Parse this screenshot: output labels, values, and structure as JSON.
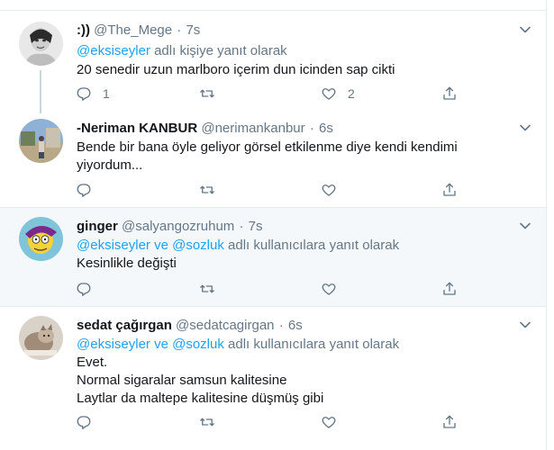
{
  "tweets": [
    {
      "name": ":))",
      "handle": "@The_Mege",
      "time": "7s",
      "reply_prefix": "",
      "mentions": "@eksiseyler",
      "reply_suffix": " adlı kişiye yanıt olarak",
      "lines": [
        "20 senedir uzun marlboro içerim dun icinden sap cikti"
      ],
      "reply_count": "1",
      "retweet_count": "",
      "like_count": "2"
    },
    {
      "name": "-Neriman KANBUR",
      "handle": "@nerimankanbur",
      "time": "6s",
      "lines": [
        "Bende bir bana öyle geliyor görsel etkilenme diye kendi kendimi",
        "yiyordum..."
      ],
      "reply_count": "",
      "retweet_count": "",
      "like_count": ""
    },
    {
      "name": "ginger",
      "handle": "@salyangozruhum",
      "time": "7s",
      "mentions": "@eksiseyler ve @sozluk",
      "reply_suffix": " adlı kullanıcılara yanıt olarak",
      "lines": [
        "Kesinlikle değişti"
      ],
      "reply_count": "",
      "retweet_count": "",
      "like_count": ""
    },
    {
      "name": "sedat çağırgan",
      "handle": "@sedatcagirgan",
      "time": "6s",
      "mentions": "@eksiseyler ve @sozluk",
      "reply_suffix": " adlı kullanıcılara yanıt olarak",
      "lines": [
        "Evet.",
        "Normal sigaralar samsun kalitesine",
        "Laytlar da maltepe kalitesine düşmüş gibi"
      ],
      "reply_count": "",
      "retweet_count": "",
      "like_count": ""
    }
  ],
  "icons": {
    "reply": "reply-icon",
    "retweet": "retweet-icon",
    "like": "heart-icon",
    "share": "share-icon",
    "caret": "chevron-down-icon"
  },
  "colors": {
    "link": "#1da1f2",
    "muted": "#657786",
    "border": "#e6ecf0",
    "highlight_bg": "#f5f8fa"
  }
}
